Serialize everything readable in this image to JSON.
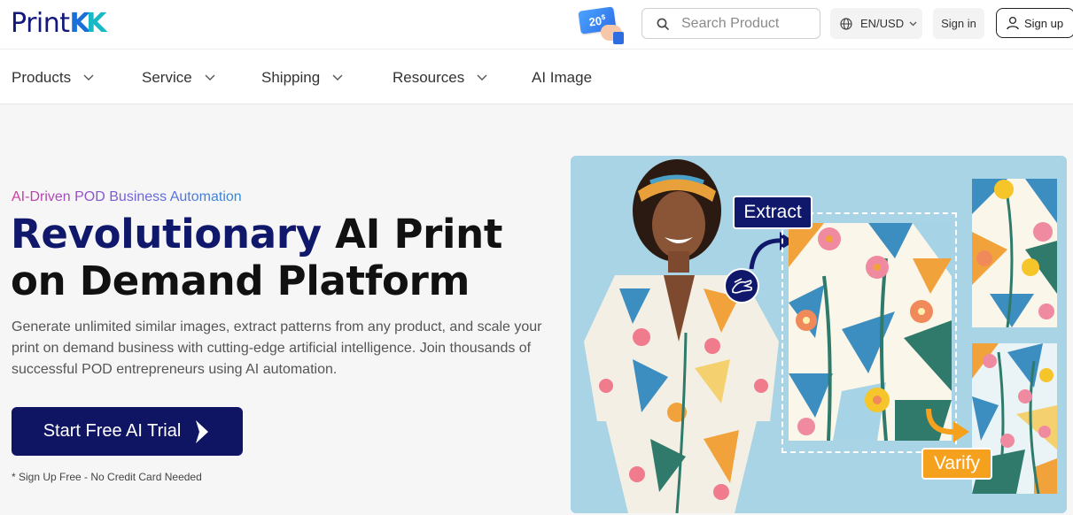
{
  "brand": {
    "logo_print": "Print",
    "logo_k1": "K",
    "logo_k2": "K"
  },
  "header": {
    "coupon": {
      "amount": "20",
      "unit": "$"
    },
    "search": {
      "placeholder": "Search Product"
    },
    "lang": {
      "label": "EN/USD"
    },
    "signin_label": "Sign in",
    "signup_label": "Sign up"
  },
  "nav": {
    "items": [
      {
        "label": "Products",
        "has_dropdown": true
      },
      {
        "label": "Service",
        "has_dropdown": true
      },
      {
        "label": "Shipping",
        "has_dropdown": true
      },
      {
        "label": "Resources",
        "has_dropdown": true
      },
      {
        "label": "AI Image",
        "has_dropdown": false
      }
    ]
  },
  "hero": {
    "eyebrow": "AI-Driven POD Business Automation",
    "headline_accent": "Revolutionary",
    "headline_rest": " AI Print on Demand Platform",
    "description": "Generate unlimited similar images, extract patterns from any product, and scale your print on demand business with cutting-edge artificial intelligence. Join thousands of successful POD entrepreneurs using AI automation.",
    "cta_label": "Start Free AI Trial",
    "note": "* Sign Up Free - No Credit Card Needed",
    "image": {
      "extract_label": "Extract",
      "verify_label": "Varify"
    }
  },
  "colors": {
    "brand_navy": "#10186b",
    "brand_blue": "#1b6fd8",
    "brand_teal": "#16b9c4",
    "hero_bg": "#f6f6f7",
    "image_bg": "#a9d4e5",
    "verify_orange": "#f5a11d"
  }
}
